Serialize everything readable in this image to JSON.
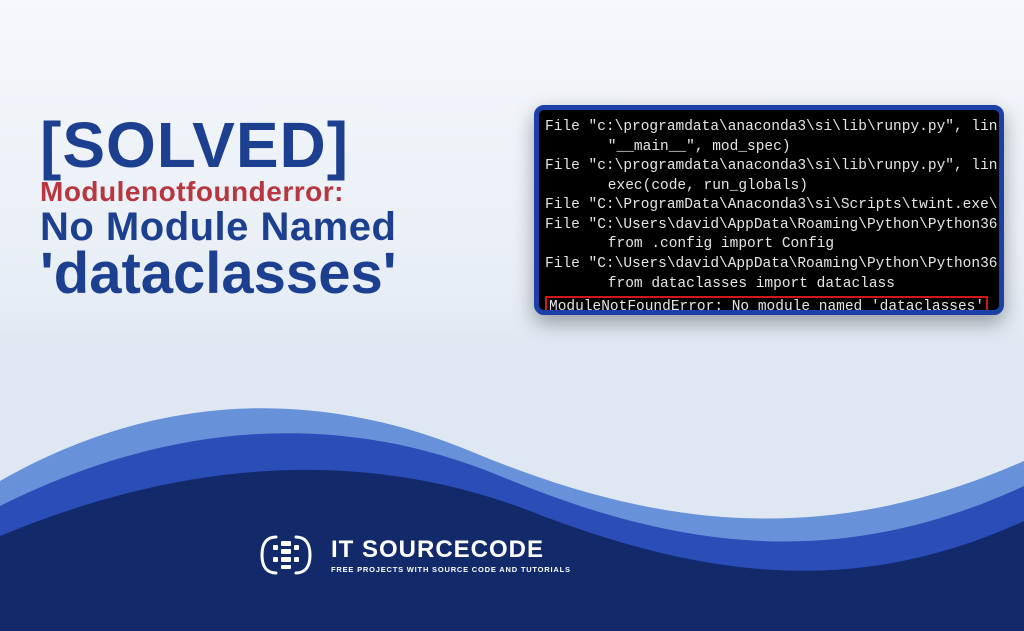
{
  "headline": {
    "solved": "[SOLVED]",
    "error_name": "Modulenotfounderror:",
    "no_module": "No Module Named",
    "module_name": "'dataclasses'"
  },
  "terminal": {
    "lines": [
      "File \"c:\\programdata\\anaconda3\\si\\lib\\runpy.py\", lin",
      "    \"__main__\", mod_spec)",
      "File \"c:\\programdata\\anaconda3\\si\\lib\\runpy.py\", lin",
      "    exec(code, run_globals)",
      "File \"C:\\ProgramData\\Anaconda3\\si\\Scripts\\twint.exe\\",
      "File \"C:\\Users\\david\\AppData\\Roaming\\Python\\Python36",
      "    from .config import Config",
      "File \"C:\\Users\\david\\AppData\\Roaming\\Python\\Python36",
      "    from dataclasses import dataclass"
    ],
    "error_text": "ModuleNotFoundError: No module named 'dataclasses'"
  },
  "logo": {
    "title": "IT SOURCECODE",
    "subtitle": "FREE PROJECTS WITH SOURCE CODE AND TUTORIALS"
  },
  "colors": {
    "navy": "#1c3f8f",
    "red": "#b7363f",
    "wave_dark": "#122a6a",
    "wave_mid": "#2a4db8",
    "wave_light": "#5a87d6",
    "terminal_border": "#1c3fa8",
    "error_border": "#d11717"
  }
}
